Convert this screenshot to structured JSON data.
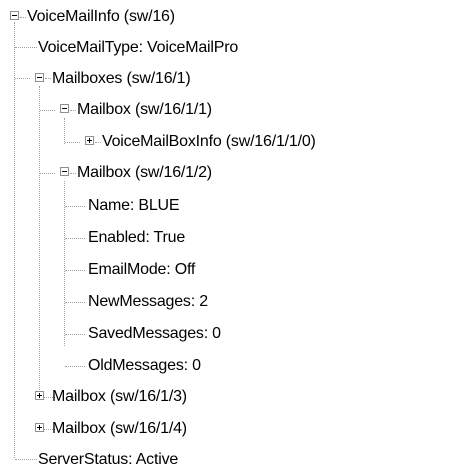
{
  "tree": {
    "root": {
      "label": "VoiceMailInfo (sw/16)",
      "expanded": true
    },
    "voicemail_type": "VoiceMailType: VoiceMailPro",
    "mailboxes": {
      "label": "Mailboxes (sw/16/1)",
      "expanded": true,
      "mailbox1": {
        "label": "Mailbox (sw/16/1/1)",
        "expanded": true,
        "voicemailboxinfo": {
          "label": "VoiceMailBoxInfo (sw/16/1/1/0)",
          "expanded": false
        }
      },
      "mailbox2": {
        "label": "Mailbox (sw/16/1/2)",
        "expanded": true,
        "properties": [
          "Name: BLUE",
          "Enabled: True",
          "EmailMode: Off",
          "NewMessages: 2",
          "SavedMessages: 0",
          "OldMessages: 0"
        ]
      },
      "mailbox3": {
        "label": "Mailbox (sw/16/1/3)",
        "expanded": false
      },
      "mailbox4": {
        "label": "Mailbox (sw/16/1/4)",
        "expanded": false
      }
    },
    "server_status": "ServerStatus: Active"
  }
}
